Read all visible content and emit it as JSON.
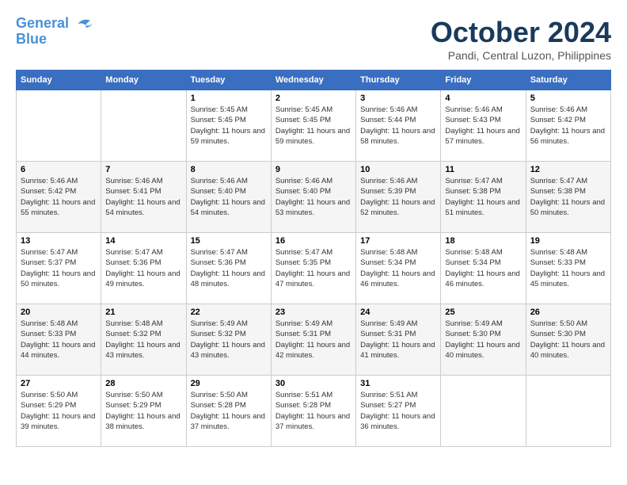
{
  "header": {
    "logo_line1": "General",
    "logo_line2": "Blue",
    "month_title": "October 2024",
    "subtitle": "Pandi, Central Luzon, Philippines"
  },
  "days_of_week": [
    "Sunday",
    "Monday",
    "Tuesday",
    "Wednesday",
    "Thursday",
    "Friday",
    "Saturday"
  ],
  "weeks": [
    [
      {
        "day": "",
        "info": ""
      },
      {
        "day": "",
        "info": ""
      },
      {
        "day": "1",
        "info": "Sunrise: 5:45 AM\nSunset: 5:45 PM\nDaylight: 11 hours and 59 minutes."
      },
      {
        "day": "2",
        "info": "Sunrise: 5:45 AM\nSunset: 5:45 PM\nDaylight: 11 hours and 59 minutes."
      },
      {
        "day": "3",
        "info": "Sunrise: 5:46 AM\nSunset: 5:44 PM\nDaylight: 11 hours and 58 minutes."
      },
      {
        "day": "4",
        "info": "Sunrise: 5:46 AM\nSunset: 5:43 PM\nDaylight: 11 hours and 57 minutes."
      },
      {
        "day": "5",
        "info": "Sunrise: 5:46 AM\nSunset: 5:42 PM\nDaylight: 11 hours and 56 minutes."
      }
    ],
    [
      {
        "day": "6",
        "info": "Sunrise: 5:46 AM\nSunset: 5:42 PM\nDaylight: 11 hours and 55 minutes."
      },
      {
        "day": "7",
        "info": "Sunrise: 5:46 AM\nSunset: 5:41 PM\nDaylight: 11 hours and 54 minutes."
      },
      {
        "day": "8",
        "info": "Sunrise: 5:46 AM\nSunset: 5:40 PM\nDaylight: 11 hours and 54 minutes."
      },
      {
        "day": "9",
        "info": "Sunrise: 5:46 AM\nSunset: 5:40 PM\nDaylight: 11 hours and 53 minutes."
      },
      {
        "day": "10",
        "info": "Sunrise: 5:46 AM\nSunset: 5:39 PM\nDaylight: 11 hours and 52 minutes."
      },
      {
        "day": "11",
        "info": "Sunrise: 5:47 AM\nSunset: 5:38 PM\nDaylight: 11 hours and 51 minutes."
      },
      {
        "day": "12",
        "info": "Sunrise: 5:47 AM\nSunset: 5:38 PM\nDaylight: 11 hours and 50 minutes."
      }
    ],
    [
      {
        "day": "13",
        "info": "Sunrise: 5:47 AM\nSunset: 5:37 PM\nDaylight: 11 hours and 50 minutes."
      },
      {
        "day": "14",
        "info": "Sunrise: 5:47 AM\nSunset: 5:36 PM\nDaylight: 11 hours and 49 minutes."
      },
      {
        "day": "15",
        "info": "Sunrise: 5:47 AM\nSunset: 5:36 PM\nDaylight: 11 hours and 48 minutes."
      },
      {
        "day": "16",
        "info": "Sunrise: 5:47 AM\nSunset: 5:35 PM\nDaylight: 11 hours and 47 minutes."
      },
      {
        "day": "17",
        "info": "Sunrise: 5:48 AM\nSunset: 5:34 PM\nDaylight: 11 hours and 46 minutes."
      },
      {
        "day": "18",
        "info": "Sunrise: 5:48 AM\nSunset: 5:34 PM\nDaylight: 11 hours and 46 minutes."
      },
      {
        "day": "19",
        "info": "Sunrise: 5:48 AM\nSunset: 5:33 PM\nDaylight: 11 hours and 45 minutes."
      }
    ],
    [
      {
        "day": "20",
        "info": "Sunrise: 5:48 AM\nSunset: 5:33 PM\nDaylight: 11 hours and 44 minutes."
      },
      {
        "day": "21",
        "info": "Sunrise: 5:48 AM\nSunset: 5:32 PM\nDaylight: 11 hours and 43 minutes."
      },
      {
        "day": "22",
        "info": "Sunrise: 5:49 AM\nSunset: 5:32 PM\nDaylight: 11 hours and 43 minutes."
      },
      {
        "day": "23",
        "info": "Sunrise: 5:49 AM\nSunset: 5:31 PM\nDaylight: 11 hours and 42 minutes."
      },
      {
        "day": "24",
        "info": "Sunrise: 5:49 AM\nSunset: 5:31 PM\nDaylight: 11 hours and 41 minutes."
      },
      {
        "day": "25",
        "info": "Sunrise: 5:49 AM\nSunset: 5:30 PM\nDaylight: 11 hours and 40 minutes."
      },
      {
        "day": "26",
        "info": "Sunrise: 5:50 AM\nSunset: 5:30 PM\nDaylight: 11 hours and 40 minutes."
      }
    ],
    [
      {
        "day": "27",
        "info": "Sunrise: 5:50 AM\nSunset: 5:29 PM\nDaylight: 11 hours and 39 minutes."
      },
      {
        "day": "28",
        "info": "Sunrise: 5:50 AM\nSunset: 5:29 PM\nDaylight: 11 hours and 38 minutes."
      },
      {
        "day": "29",
        "info": "Sunrise: 5:50 AM\nSunset: 5:28 PM\nDaylight: 11 hours and 37 minutes."
      },
      {
        "day": "30",
        "info": "Sunrise: 5:51 AM\nSunset: 5:28 PM\nDaylight: 11 hours and 37 minutes."
      },
      {
        "day": "31",
        "info": "Sunrise: 5:51 AM\nSunset: 5:27 PM\nDaylight: 11 hours and 36 minutes."
      },
      {
        "day": "",
        "info": ""
      },
      {
        "day": "",
        "info": ""
      }
    ]
  ]
}
